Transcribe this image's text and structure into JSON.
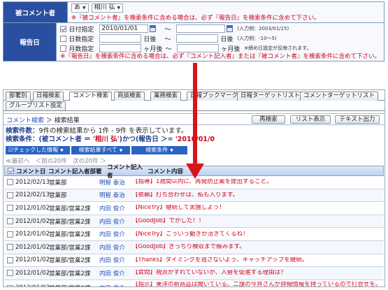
{
  "form": {
    "commenter": {
      "label": "被コメント者",
      "select1": "あ",
      "select2": "相川 弘",
      "note": "※『被コメント者』を検索条件に含める場合は、必ず『報告日』を検索条件に含めて下さい。"
    },
    "report_date": {
      "label": "報告日",
      "day": {
        "label": "日付指定",
        "from": "2010/01/01",
        "tilde": "〜",
        "to": "",
        "hint": "(入力例：2003/01/15)"
      },
      "days": {
        "label": "日数指定",
        "unit": "日後",
        "tilde": "〜",
        "unit2": "日後",
        "hint": "(入力例：-10〜5)"
      },
      "months": {
        "label": "月数指定",
        "unit": "ヶ月後",
        "tilde": "〜",
        "unit2": "ヶ月後",
        "hint": "※締め日設定が反映されます。"
      },
      "note": "※『報告日』を検索条件に含める場合は、必ず『コメント記入者』または『被コメント者』を検索条件に含めて下さい。"
    }
  },
  "tabs": {
    "row1": [
      "部署別",
      "日報検索",
      "コメント検索",
      "商談検索",
      "業務検索",
      "日報ブックマーク",
      "日報ターゲットリスト",
      "コメントターゲットリスト"
    ],
    "row2": [
      "グループリスト設定"
    ]
  },
  "breadcrumb": {
    "link": "コメント検索",
    "sep": "＞",
    "current": "検索結果",
    "buttons": [
      "再検索",
      "リスト表示",
      "テキスト出力"
    ]
  },
  "info": {
    "count_label": "検索件数：",
    "count_text": "9件の検索結果から 1件 - 9件 を表示しています。",
    "cond_label": "検索条件：",
    "cond_prefix": "(被コメント者 ＝ ",
    "cond_value1": "'相川 弘'",
    "cond_mid": ")かつ(報告日 ＞= ",
    "cond_value2": "'2010/01/0"
  },
  "actions": [
    "チェックした情報",
    "検索結果すべて",
    "検索条件"
  ],
  "pager": "≪最初へ　＜前の20件　次の20件 ＞",
  "table": {
    "headers": [
      "コメント日",
      "コメント記入者部署",
      "コメント記入者",
      "コメント内容"
    ],
    "rows": [
      {
        "date": "2012/02/13",
        "dept": "営業部",
        "name": "明智 泰治",
        "text": "【指導】1週間以内に、再発防止案を提出すること。"
      },
      {
        "date": "2012/02/13",
        "dept": "営業部",
        "name": "明智 泰治",
        "text": "【依頼】打ち合わせは、私も入ります。"
      },
      {
        "date": "2012/01/02",
        "dept": "営業部/営業2課",
        "name": "内田 俊介",
        "text": "【NiceTry】継続して実施しよう！"
      },
      {
        "date": "2012/01/02",
        "dept": "営業部/営業2課",
        "name": "内田 俊介",
        "text": "【GoodJob】でかした！！"
      },
      {
        "date": "2012/01/02",
        "dept": "営業部/営業2課",
        "name": "内田 俊介",
        "text": "【NiceTry】こういう動きが活きてくるね！"
      },
      {
        "date": "2012/01/02",
        "dept": "営業部/営業2課",
        "name": "内田 俊介",
        "text": "【GoodJob】ぎっちり検収まで稼みます。"
      },
      {
        "date": "2012/01/02",
        "dept": "営業部/営業2課",
        "name": "内田 俊介",
        "text": "【Thanks】タイミングを逃さないよう、キャッチアップを継続。"
      },
      {
        "date": "2012/01/02",
        "dept": "営業部/営業2課",
        "name": "内田 俊介",
        "text": "【質問】視点がずれていないか、入替を促進する理由は？"
      },
      {
        "date": "2012/01/02",
        "dept": "営業部/営業2課",
        "name": "内田 俊介",
        "text": "【指示】東洋の新商品は聞いている。二課の今井さんが詳細情報を持っているので打合せを。資料は佐々木医師に直接説明できないか、私も行くので同行アポを。"
      }
    ]
  }
}
